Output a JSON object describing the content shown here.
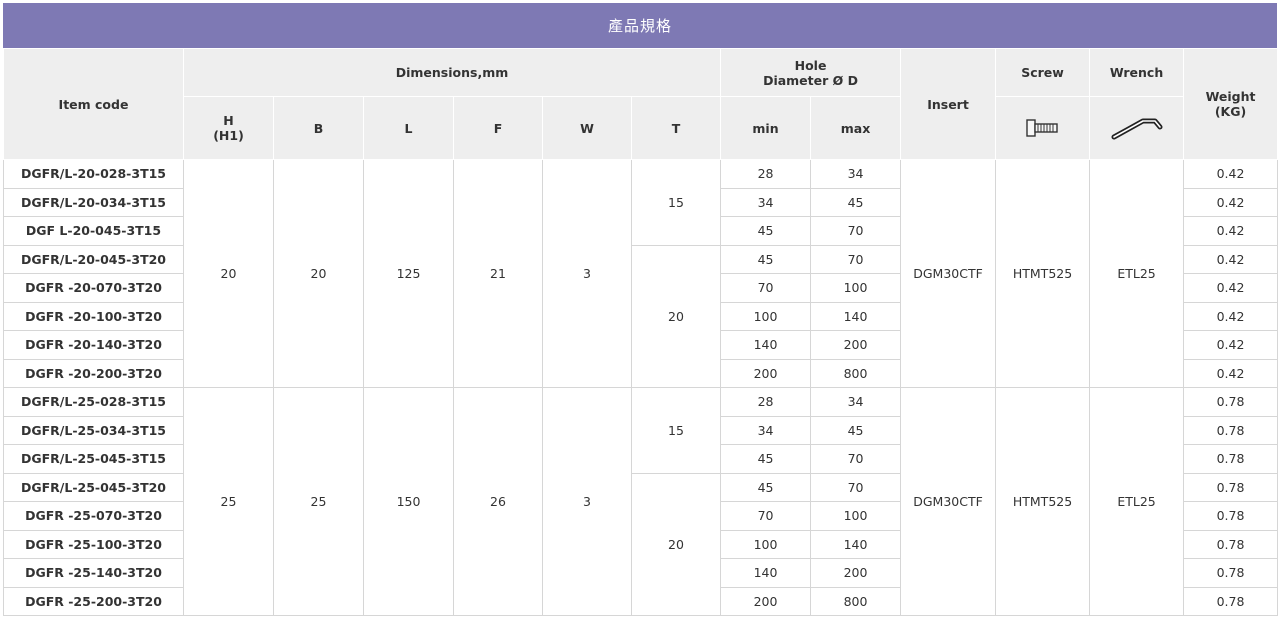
{
  "title": "產品規格",
  "headers": {
    "item_code": "Item code",
    "dimensions": "Dimensions,mm",
    "hole_line1": "Hole",
    "hole_line2": "Diameter Ø D",
    "insert": "Insert",
    "screw": "Screw",
    "wrench": "Wrench",
    "weight_line1": "Weight",
    "weight_line2": "(KG)",
    "h_line1": "H",
    "h_line2": "(H1)",
    "b": "B",
    "l": "L",
    "f": "F",
    "w": "W",
    "t": "T",
    "min": "min",
    "max": "max",
    "screw_icon": "screw-icon",
    "wrench_icon": "wrench-icon"
  },
  "groups": [
    {
      "H": "20",
      "B": "20",
      "L": "125",
      "F": "21",
      "W": "3",
      "insert": "DGM30CTF",
      "screw": "HTMT525",
      "wrench": "ETL25",
      "T15": "15",
      "T20": "20",
      "rows": [
        {
          "code": "DGFR/L-20-028-3T15",
          "min": "28",
          "max": "34",
          "weight": "0.42"
        },
        {
          "code": "DGFR/L-20-034-3T15",
          "min": "34",
          "max": "45",
          "weight": "0.42"
        },
        {
          "code": "DGF L-20-045-3T15",
          "min": "45",
          "max": "70",
          "weight": "0.42"
        },
        {
          "code": "DGFR/L-20-045-3T20",
          "min": "45",
          "max": "70",
          "weight": "0.42"
        },
        {
          "code": "DGFR -20-070-3T20",
          "min": "70",
          "max": "100",
          "weight": "0.42"
        },
        {
          "code": "DGFR -20-100-3T20",
          "min": "100",
          "max": "140",
          "weight": "0.42"
        },
        {
          "code": "DGFR -20-140-3T20",
          "min": "140",
          "max": "200",
          "weight": "0.42"
        },
        {
          "code": "DGFR -20-200-3T20",
          "min": "200",
          "max": "800",
          "weight": "0.42"
        }
      ]
    },
    {
      "H": "25",
      "B": "25",
      "L": "150",
      "F": "26",
      "W": "3",
      "insert": "DGM30CTF",
      "screw": "HTMT525",
      "wrench": "ETL25",
      "T15": "15",
      "T20": "20",
      "rows": [
        {
          "code": "DGFR/L-25-028-3T15",
          "min": "28",
          "max": "34",
          "weight": "0.78"
        },
        {
          "code": "DGFR/L-25-034-3T15",
          "min": "34",
          "max": "45",
          "weight": "0.78"
        },
        {
          "code": "DGFR/L-25-045-3T15",
          "min": "45",
          "max": "70",
          "weight": "0.78"
        },
        {
          "code": "DGFR/L-25-045-3T20",
          "min": "45",
          "max": "70",
          "weight": "0.78"
        },
        {
          "code": "DGFR -25-070-3T20",
          "min": "70",
          "max": "100",
          "weight": "0.78"
        },
        {
          "code": "DGFR -25-100-3T20",
          "min": "100",
          "max": "140",
          "weight": "0.78"
        },
        {
          "code": "DGFR -25-140-3T20",
          "min": "140",
          "max": "200",
          "weight": "0.78"
        },
        {
          "code": "DGFR -25-200-3T20",
          "min": "200",
          "max": "800",
          "weight": "0.78"
        }
      ]
    }
  ]
}
